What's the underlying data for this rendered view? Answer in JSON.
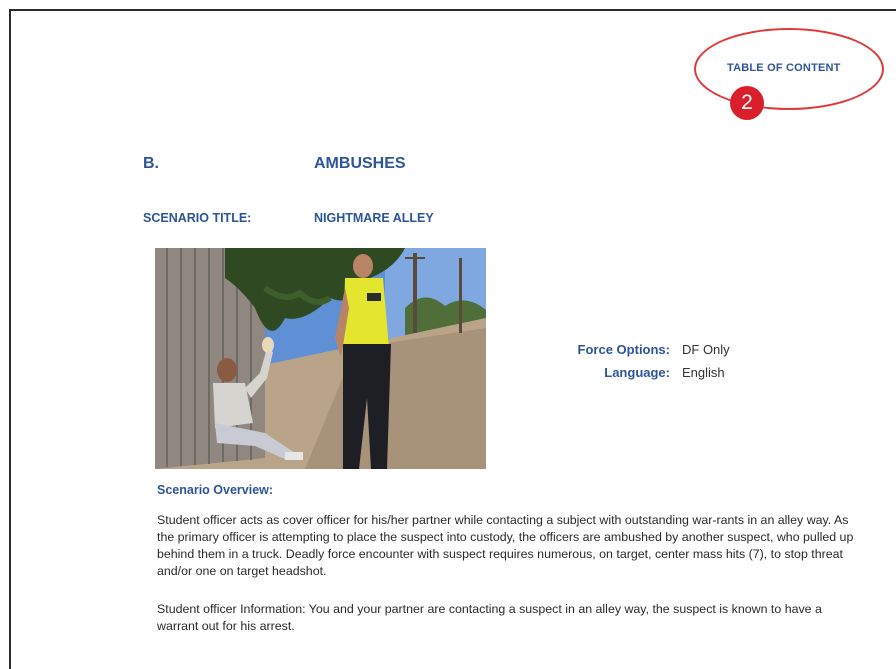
{
  "toc": {
    "label": "TABLE OF CONTENT",
    "badge": "2"
  },
  "section": {
    "letter": "B.",
    "title": "AMBUSHES"
  },
  "scenario": {
    "label": "SCENARIO TITLE:",
    "value": "NIGHTMARE ALLEY"
  },
  "meta": {
    "force_label": "Force Options:",
    "force_value": "DF Only",
    "language_label": "Language:",
    "language_value": "English"
  },
  "overview": {
    "heading": "Scenario Overview:",
    "paragraph1": "Student officer acts as cover officer for his/her partner while contacting a subject with outstanding war-rants in an alley way. As the primary officer is attempting to place the suspect into custody, the officers are ambushed by another suspect, who pulled up behind them in a truck.  Deadly force encounter with suspect requires numerous, on target, center mass hits (7), to stop threat and/or one on target headshot.",
    "paragraph2": "Student officer Information:  You and your partner are contacting a suspect in an alley way, the suspect is known to have a warrant out for his arrest."
  },
  "colors": {
    "accent_blue": "#2e5597",
    "annotation_red": "#d9202a"
  }
}
